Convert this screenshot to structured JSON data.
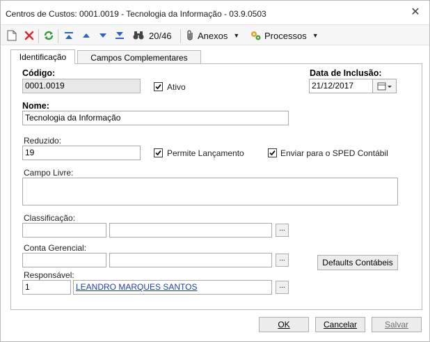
{
  "window": {
    "title": "Centros de Custos: 0001.0019 - Tecnologia da Informação - 03.9.0503"
  },
  "toolbar": {
    "record_counter": "20/46",
    "anexos_label": "Anexos",
    "processos_label": "Processos"
  },
  "tabs": [
    {
      "label": "Identificação",
      "active": true
    },
    {
      "label": "Campos Complementares",
      "active": false
    }
  ],
  "form": {
    "codigo_label": "Código:",
    "codigo_value": "0001.0019",
    "ativo_label": "Ativo",
    "ativo_checked": true,
    "data_label": "Data de Inclusão:",
    "data_value": "21/12/2017",
    "nome_label": "Nome:",
    "nome_value": "Tecnologia da Informação",
    "reduzido_label": "Reduzido:",
    "reduzido_value": "19",
    "permite_label": "Permite Lançamento",
    "permite_checked": true,
    "sped_label": "Enviar para o SPED Contábil",
    "sped_checked": true,
    "campo_livre_label": "Campo Livre:",
    "campo_livre_value": "",
    "classificacao_label": "Classificação:",
    "classificacao_code": "",
    "classificacao_desc": "",
    "conta_label": "Conta Gerencial:",
    "conta_code": "",
    "conta_desc": "",
    "defaults_label": "Defaults Contábeis",
    "responsavel_label": "Responsável:",
    "responsavel_code": "1",
    "responsavel_name": "LEANDRO MARQUES SANTOS",
    "ellipsis": "..."
  },
  "buttons": {
    "ok": "OK",
    "cancelar": "Cancelar",
    "salvar": "Salvar"
  },
  "colors": {
    "delete_red": "#d9262b",
    "refresh_green": "#2d9a3a",
    "nav_blue": "#2c63c7",
    "link_blue": "#1b3fb5"
  }
}
